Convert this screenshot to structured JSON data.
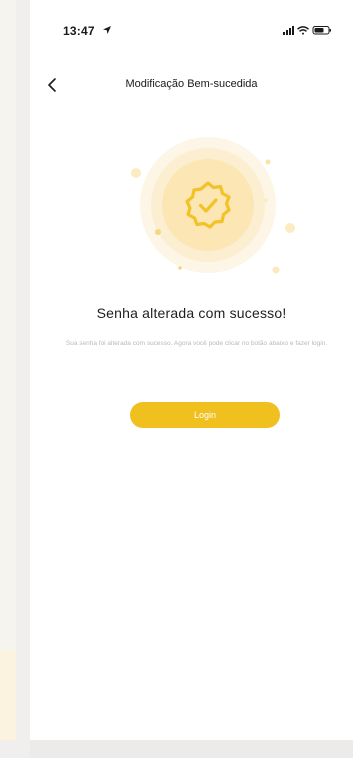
{
  "status_bar": {
    "time": "13:47"
  },
  "nav": {
    "title": "Modificação Bem-sucedida"
  },
  "content": {
    "title": "Senha alterada com sucesso!",
    "description": "Sua senha foi alterada com sucesso. Agora você pode clicar no botão abaixo e fazer login.",
    "login_label": "Login"
  },
  "colors": {
    "accent": "#f0c01f",
    "badge": "#f2c227",
    "halo_outer": "#fdf5e3",
    "halo_inner": "#fbe9be"
  },
  "icons": {
    "back": "chevron-left-icon",
    "badge": "verified-badge-icon",
    "location": "location-arrow-icon",
    "signal": "cellular-signal-icon",
    "wifi": "wifi-icon",
    "battery": "battery-icon"
  }
}
